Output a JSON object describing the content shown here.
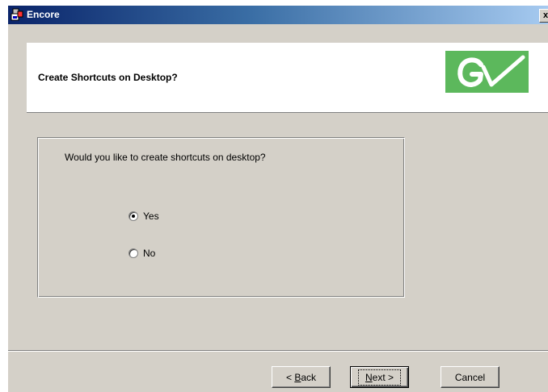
{
  "window": {
    "title": "Encore",
    "close_glyph": "x"
  },
  "header": {
    "title": "Create Shortcuts on Desktop?",
    "logo_icon": "gv-logo-icon",
    "logo_color": "#5cb85c"
  },
  "content": {
    "question": "Would you like to create shortcuts on desktop?",
    "options": [
      {
        "label": "Yes",
        "checked": true
      },
      {
        "label": "No",
        "checked": false
      }
    ]
  },
  "buttons": {
    "back_prefix": "< ",
    "back_accel": "B",
    "back_rest": "ack",
    "next_accel": "N",
    "next_rest": "ext >",
    "cancel": "Cancel"
  },
  "colors": {
    "dialog_bg": "#d4d0c8",
    "titlebar_start": "#0a246a",
    "titlebar_end": "#a6caf0"
  }
}
